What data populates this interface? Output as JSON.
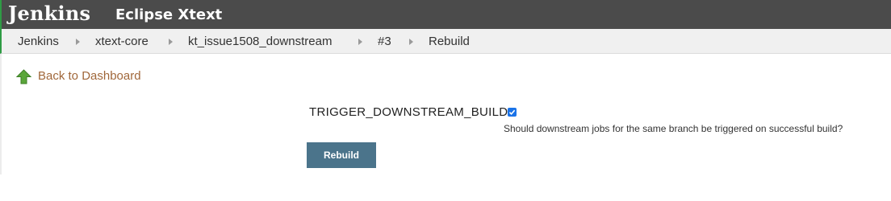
{
  "header": {
    "logo": "Jenkins",
    "instance": "Eclipse Xtext"
  },
  "breadcrumbs": [
    {
      "label": "Jenkins"
    },
    {
      "label": "xtext-core"
    },
    {
      "label": "kt_issue1508_downstream"
    },
    {
      "label": "#3"
    },
    {
      "label": "Rebuild"
    }
  ],
  "sidebar": {
    "back_link": "Back to Dashboard",
    "back_icon": "green-up-arrow-icon"
  },
  "form": {
    "parameter": {
      "name": "TRIGGER_DOWNSTREAM_BUILD",
      "checked": true,
      "description": "Should downstream jobs for the same branch be triggered on successful build?"
    },
    "submit_label": "Rebuild"
  },
  "colors": {
    "header_bg": "#4b4b4b",
    "breadcrumb_bg": "#f0f0f0",
    "link": "#a0673a",
    "button_bg": "#4b748b",
    "checkbox": "#1a73e8",
    "accent_green": "#2f9b45"
  }
}
